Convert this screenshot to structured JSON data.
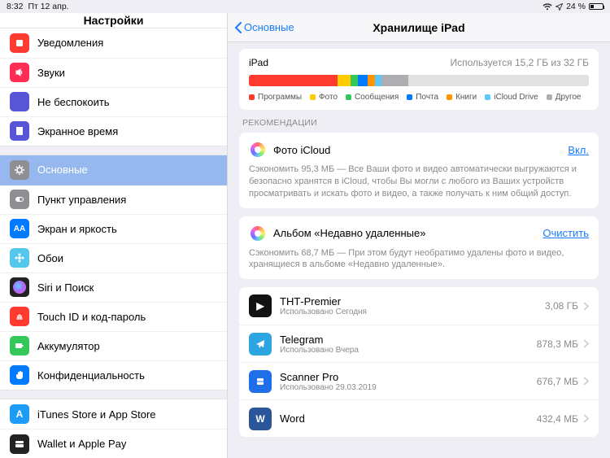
{
  "statusbar": {
    "time": "8:32",
    "date": "Пт 12 апр.",
    "battery": "24 %"
  },
  "sidebar": {
    "title": "Настройки",
    "g1": [
      {
        "label": "Уведомления",
        "color": "#ff3b30",
        "glyph": "sq"
      },
      {
        "label": "Звуки",
        "color": "#ff2d55",
        "glyph": "spk"
      },
      {
        "label": "Не беспокоить",
        "color": "#5856d6",
        "glyph": "moon"
      },
      {
        "label": "Экранное время",
        "color": "#5856d6",
        "glyph": "hour"
      }
    ],
    "g2": [
      {
        "label": "Основные",
        "color": "#8e8e93",
        "glyph": "gear",
        "selected": true
      },
      {
        "label": "Пункт управления",
        "color": "#8e8e93",
        "glyph": "switch"
      },
      {
        "label": "Экран и яркость",
        "color": "#007aff",
        "glyph": "AA"
      },
      {
        "label": "Обои",
        "color": "#54c7ec",
        "glyph": "flower"
      },
      {
        "label": "Siri и Поиск",
        "color": "#222",
        "glyph": "siri"
      },
      {
        "label": "Touch ID и код-пароль",
        "color": "#ff3b30",
        "glyph": "finger"
      },
      {
        "label": "Аккумулятор",
        "color": "#34c759",
        "glyph": "batt"
      },
      {
        "label": "Конфиденциальность",
        "color": "#007aff",
        "glyph": "hand"
      }
    ],
    "g3": [
      {
        "label": "iTunes Store и App Store",
        "color": "#1d9bf6",
        "glyph": "А"
      },
      {
        "label": "Wallet и Apple Pay",
        "color": "#222",
        "glyph": "wallet"
      }
    ]
  },
  "main": {
    "back": "Основные",
    "title": "Хранилище iPad",
    "storage": {
      "device": "iPad",
      "usage": "Используется 15,2 ГБ из 32 ГБ",
      "legend": [
        "Программы",
        "Фото",
        "Сообщения",
        "Почта",
        "Книги",
        "iCloud Drive",
        "Другое"
      ],
      "legendColors": [
        "#ff3b30",
        "#ffcc00",
        "#34c759",
        "#007aff",
        "#ff9500",
        "#5ac8fa",
        "#aeaeb2"
      ]
    },
    "recLabel": "РЕКОМЕНДАЦИИ",
    "rec": [
      {
        "title": "Фото iCloud",
        "action": "Вкл.",
        "desc": "Сэкономить 95,3 МБ — Все Ваши фото и видео автоматически выгружаются и безопасно хранятся в iCloud, чтобы Вы могли с любого из Ваших устройств просматривать и искать фото и видео, а также получать к ним общий доступ."
      },
      {
        "title": "Альбом «Недавно удаленные»",
        "action": "Очистить",
        "desc": "Сэкономить 68,7 МБ — При этом будут необратимо удалены фото и видео, хранящиеся в альбоме «Недавно удаленные»."
      }
    ],
    "apps": [
      {
        "name": "ТНТ-Premier",
        "sub": "Использовано Сегодня",
        "size": "3,08 ГБ",
        "bg": "#111",
        "glyph": "▶"
      },
      {
        "name": "Telegram",
        "sub": "Использовано Вчера",
        "size": "878,3 МБ",
        "bg": "#2da5e1",
        "glyph": "tg"
      },
      {
        "name": "Scanner Pro",
        "sub": "Использовано 29.03.2019",
        "size": "676,7 МБ",
        "bg": "#1e6fe8",
        "glyph": "scan"
      },
      {
        "name": "Word",
        "sub": "",
        "size": "432,4 МБ",
        "bg": "#2b579a",
        "glyph": "W"
      }
    ]
  }
}
